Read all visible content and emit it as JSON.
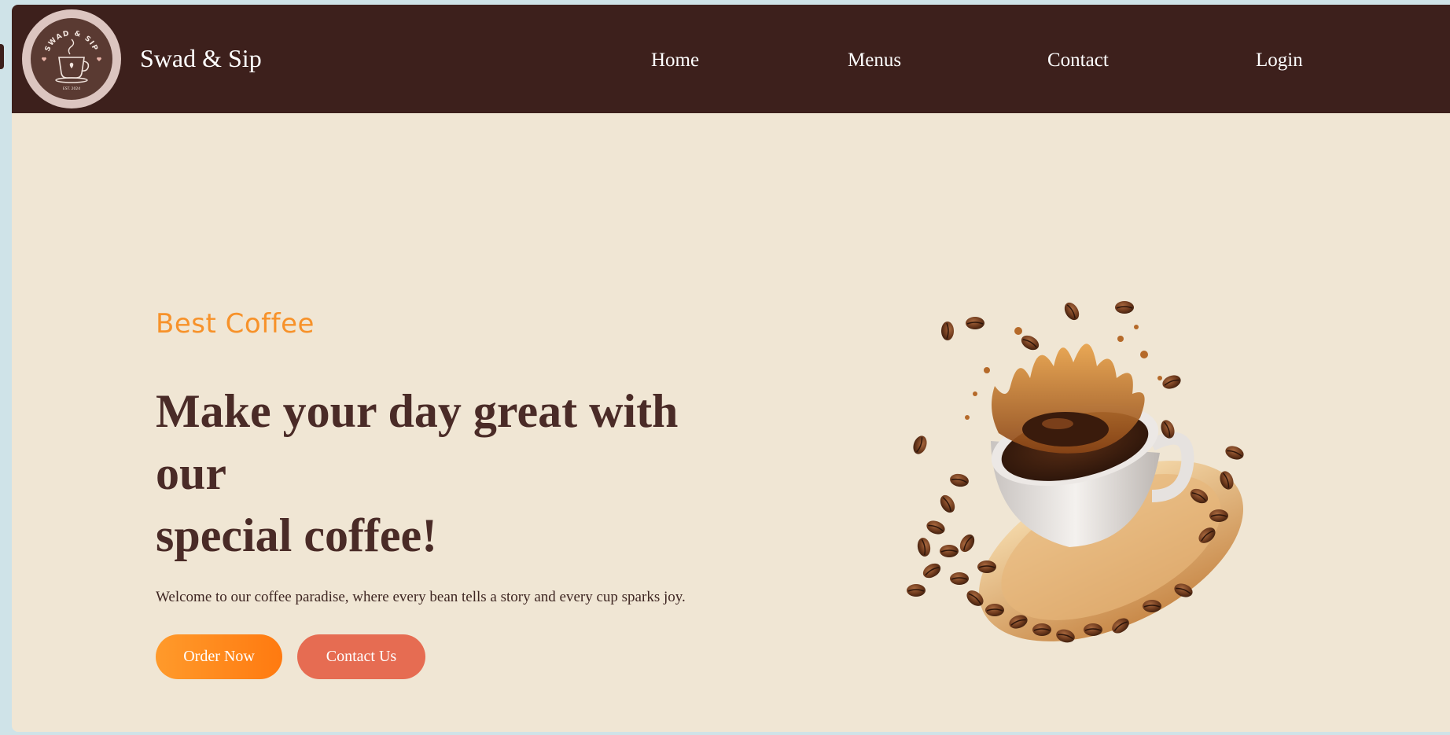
{
  "navbar": {
    "logo": {
      "ring_text": "SWAD & SIP",
      "est_text": "EST. 2024",
      "icon": "coffee-cup-icon"
    },
    "brand": "Swad & Sip",
    "links": [
      {
        "label": "Home"
      },
      {
        "label": "Menus"
      },
      {
        "label": "Contact"
      },
      {
        "label": "Login"
      }
    ]
  },
  "hero": {
    "tagline": "Best Coffee",
    "headline_lines": [
      "Make your day great with",
      "our",
      "special coffee!"
    ],
    "lead": "Welcome to our coffee paradise, where every bean tells a story and every cup sparks joy.",
    "buttons": {
      "order": "Order Now",
      "contact": "Contact Us"
    },
    "image": "coffee-cup-splash-illustration"
  },
  "colors": {
    "navbar": "#3d201c",
    "page_bg": "#f0e6d4",
    "tagline": "#f7922a",
    "headline": "#4a2b27",
    "order_button": "#ff8a1c",
    "contact_button": "#e66c52",
    "outer_bg": "#cfe3e8"
  }
}
